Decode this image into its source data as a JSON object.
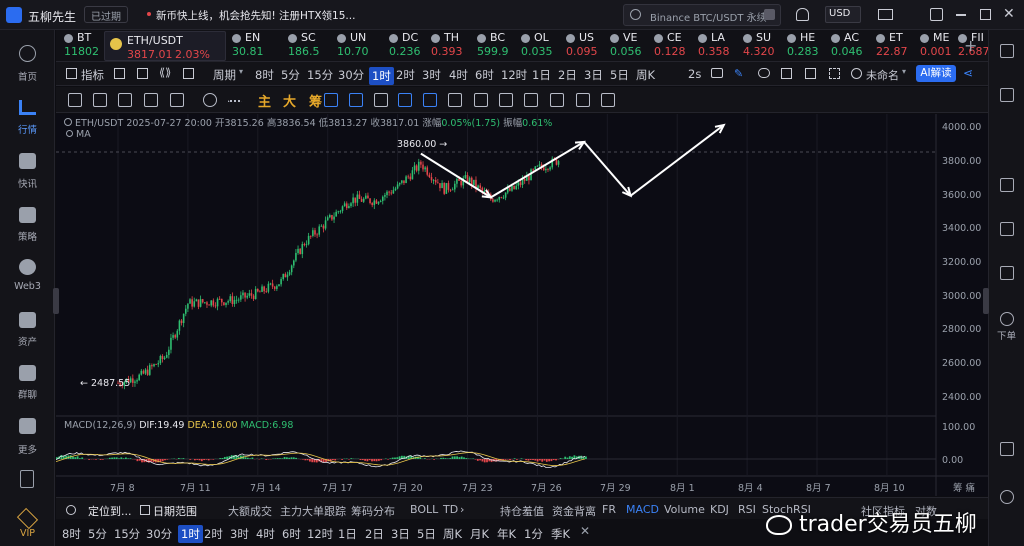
{
  "titlebar": {
    "app_name": "五柳先生",
    "status": "已过期",
    "news": "新币快上线，机会抢先知! 注册HTX领15...",
    "search_placeholder": "Binance BTC/USDT 永续",
    "currency": "USD"
  },
  "tickers": [
    {
      "sym": "BT",
      "price": "11802",
      "dir": "up"
    },
    {
      "sym": "ETH/USDT",
      "price": "3817.01",
      "change": "2.03%",
      "dir": "down",
      "active": true
    },
    {
      "sym": "EN",
      "price": "30.81",
      "dir": "up"
    },
    {
      "sym": "SC",
      "price": "186.5",
      "dir": "up"
    },
    {
      "sym": "UN",
      "price": "10.70",
      "dir": "up"
    },
    {
      "sym": "DC",
      "price": "0.236",
      "dir": "up"
    },
    {
      "sym": "TH",
      "price": "0.393",
      "dir": "down"
    },
    {
      "sym": "BC",
      "price": "599.9",
      "dir": "up"
    },
    {
      "sym": "OL",
      "price": "0.035",
      "dir": "up"
    },
    {
      "sym": "US",
      "price": "0.095",
      "dir": "down"
    },
    {
      "sym": "VE",
      "price": "0.056",
      "dir": "up"
    },
    {
      "sym": "CE",
      "price": "0.128",
      "dir": "down"
    },
    {
      "sym": "LA",
      "price": "0.358",
      "dir": "down"
    },
    {
      "sym": "SU",
      "price": "4.320",
      "dir": "down"
    },
    {
      "sym": "HE",
      "price": "0.283",
      "dir": "up"
    },
    {
      "sym": "AC",
      "price": "0.046",
      "dir": "up"
    },
    {
      "sym": "ET",
      "price": "22.87",
      "dir": "down"
    },
    {
      "sym": "ME",
      "price": "0.001",
      "dir": "down"
    },
    {
      "sym": "FII",
      "price": "2.687",
      "dir": "down"
    }
  ],
  "toolbar": {
    "indicator": "指标",
    "period": "周期",
    "timeframes": [
      "8时",
      "5分",
      "15分",
      "30分",
      "1时",
      "2时",
      "3时",
      "4时",
      "6时",
      "12时",
      "1日",
      "2日",
      "3日",
      "5日",
      "周K"
    ],
    "active_tf": "1时",
    "interval_2s": "2s",
    "layout_name": "未命名",
    "ai_button": "AI解读"
  },
  "drawtools": [
    "主",
    "大",
    "筹"
  ],
  "sidebar": [
    "首页",
    "行情",
    "快讯",
    "策略",
    "Web3",
    "资产",
    "群聊",
    "更多",
    "VIP"
  ],
  "rightbar": {
    "download": "下单"
  },
  "chart_header": {
    "pair": "ETH/USDT",
    "date": "2025-07-27 20:00",
    "open_label": "开",
    "open": "3815.26",
    "high_label": "高",
    "high": "3836.54",
    "low_label": "低",
    "low": "3813.27",
    "close_label": "收",
    "close": "3817.01",
    "chg_label": "涨幅",
    "chg": "0.05%(1.75)",
    "amp_label": "振幅",
    "amp": "0.61%",
    "ma": "MA"
  },
  "chart_annotations": {
    "high_marker": "3860.00",
    "low_marker": "2487.55"
  },
  "macd_header": {
    "name": "MACD(12,26,9)",
    "dif": "DIF:19.49",
    "dea": "DEA:16.00",
    "macd": "MACD:6.98"
  },
  "chart_data": {
    "type": "candlestick",
    "pair": "ETH/USDT",
    "interval": "1h",
    "ylim": [
      2350,
      4050
    ],
    "yticks": [
      4000,
      3800,
      3600,
      3400,
      3200,
      3000,
      2800,
      2600,
      2400
    ],
    "x_ticks": [
      "7月 8",
      "7月 11",
      "7月 14",
      "7月 17",
      "7月 20",
      "7月 23",
      "7月 26",
      "7月 29",
      "8月 1",
      "8月 4",
      "8月 7",
      "8月 10"
    ],
    "path": [
      [
        "7月 8",
        2487
      ],
      [
        "7月 9",
        2530
      ],
      [
        "7月 10",
        2640
      ],
      [
        "7月 11",
        2960
      ],
      [
        "7月 12",
        2970
      ],
      [
        "7月 13",
        2980
      ],
      [
        "7月 14",
        3020
      ],
      [
        "7月 15",
        3090
      ],
      [
        "7月 16",
        3320
      ],
      [
        "7月 17",
        3450
      ],
      [
        "7月 18",
        3580
      ],
      [
        "7月 19",
        3570
      ],
      [
        "7月 20",
        3650
      ],
      [
        "7月 21",
        3790
      ],
      [
        "7月 22",
        3640
      ],
      [
        "7月 23",
        3700
      ],
      [
        "7月 24",
        3580
      ],
      [
        "7月 25",
        3640
      ],
      [
        "7月 26",
        3760
      ],
      [
        "7月 27",
        3817
      ]
    ],
    "projection": [
      [
        "7月 21",
        3850
      ],
      [
        "7月 24",
        3590
      ],
      [
        "7月 28",
        3920
      ],
      [
        "7月 30",
        3600
      ],
      [
        "8月 3",
        4020
      ]
    ],
    "macd_ylim": [
      -40,
      120
    ],
    "macd_yticks": [
      100,
      0
    ]
  },
  "macd_ylabels": [
    "100.00",
    "0.00"
  ],
  "bottom_bar": {
    "locate": "定位到...",
    "range": "日期范围",
    "items": [
      "大额成交",
      "主力大单跟踪",
      "筹码分布",
      "BOLL",
      "TD"
    ],
    "right_items": [
      "持仓羞值",
      "资金背离",
      "FR",
      "MACD",
      "Volume",
      "KDJ",
      "RSI",
      "StochRSI"
    ],
    "community": "社区指标",
    "compare": "对数"
  },
  "bottom_tfs": [
    "8时",
    "5分",
    "15分",
    "30分",
    "1时",
    "2时",
    "3时",
    "4时",
    "6时",
    "12时",
    "1日",
    "2日",
    "3日",
    "5日",
    "周K",
    "月K",
    "年K",
    "1分",
    "季K"
  ],
  "watermark": "trader交易员五柳",
  "colors": {
    "up": "#2fbf71",
    "down": "#e2464a",
    "accent": "#1d4fc4",
    "arrow": "#ffffff"
  }
}
